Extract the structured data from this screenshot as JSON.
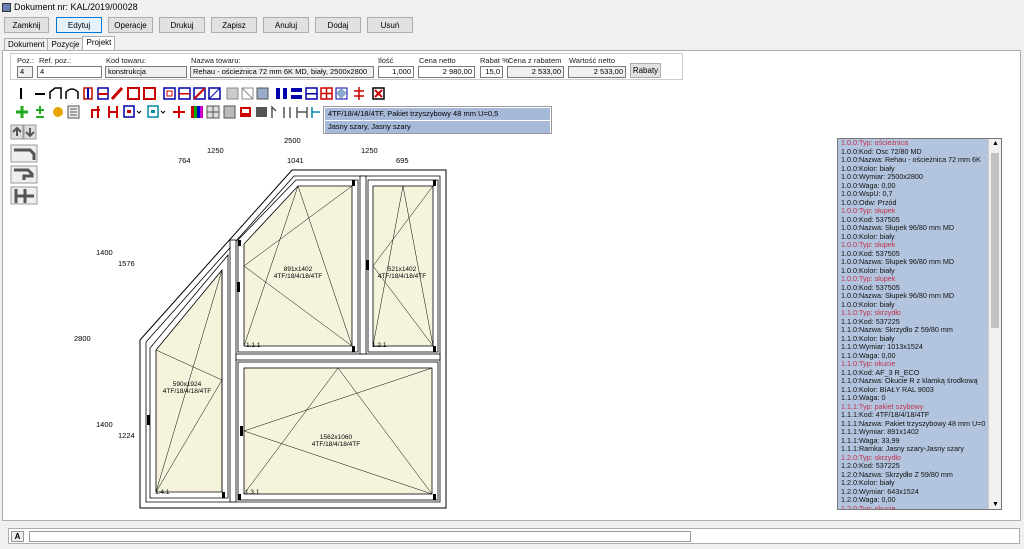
{
  "window": {
    "title": "Dokument nr: KAL/2019/00028"
  },
  "toolbar": {
    "buttons": [
      "Zamknij",
      "Edytuj",
      "Operacje",
      "Drukuj",
      "Zapisz",
      "Anuluj",
      "Dodaj",
      "Usuń"
    ]
  },
  "tabs": [
    "Dokument",
    "Pozycje",
    "Projekt"
  ],
  "form": {
    "poz_label": "Poz.:",
    "poz_value": "4",
    "refpoz_label": "Ref. poz.:",
    "refpoz_value": "4",
    "kod_label": "Kod towaru:",
    "kod_value": "konstrukcja",
    "nazwa_label": "Nazwa towaru:",
    "nazwa_value": "Rehau - ościeżnica 72 mm 6K MD, biały, 2500x2800",
    "ilosc_label": "Ilość",
    "ilosc_value": "1,000",
    "cena_label": "Cena netto",
    "cena_value": "2 980,00",
    "rabat_label": "Rabat %",
    "rabat_value": "15,0",
    "cenarabat_label": "Cena z rabatem",
    "cenarabat_value": "2 533,00",
    "wartosc_label": "Wartość netto",
    "wartosc_value": "2 533,00",
    "rabaty_button": "Rabaty"
  },
  "popup": {
    "line1": "4TF/18/4/18/4TF, Pakiet trzyszybowy 48 mm U=0,5",
    "line2": "Jasny szary, Jasny szary"
  },
  "drawing": {
    "dims": [
      "2500",
      "1250",
      "1250",
      "764",
      "1041",
      "695",
      "1400",
      "1576",
      "2800",
      "1400",
      "1224"
    ],
    "glass": [
      {
        "size": "891x1402",
        "spec": "4TF/18/4/18/4TF",
        "id": "1.1.1"
      },
      {
        "size": "521x1402",
        "spec": "4TF/18/4/18/4TF",
        "id": "1.2.1"
      },
      {
        "size": "590x1924",
        "spec": "4TF/18/4/18/4TF",
        "id": "1.4.1"
      },
      {
        "size": "1562x1060",
        "spec": "4TF/18/4/18/4TF",
        "id": "1.3.1"
      }
    ]
  },
  "properties": [
    {
      "t": "1.0.0:Typ: ościeżnica",
      "red": true
    },
    {
      "t": "1.0.0:Kod: Osc 72/80 MD"
    },
    {
      "t": "1.0.0:Nazwa: Rehau - ościeżnica 72 mm 6K"
    },
    {
      "t": "1.0.0:Kolor: biały"
    },
    {
      "t": "1.0.0:Wymiar: 2500x2800"
    },
    {
      "t": "1.0.0:Waga: 0,00"
    },
    {
      "t": "1.0.0:WspU: 0,7"
    },
    {
      "t": "1.0.0:Odw: Przód"
    },
    {
      "t": "1.0.0:Typ: słupek",
      "red": true
    },
    {
      "t": "1.0.0:Kod: 537505"
    },
    {
      "t": "1.0.0:Nazwa: Słupek 96/80 mm MD"
    },
    {
      "t": "1.0.0:Kolor: biały"
    },
    {
      "t": "1.0.0:Typ: słupek",
      "red": true
    },
    {
      "t": "1.0.0:Kod: 537505"
    },
    {
      "t": "1.0.0:Nazwa: Słupek 96/80 mm MD"
    },
    {
      "t": "1.0.0:Kolor: biały"
    },
    {
      "t": "1.0.0:Typ: słupek",
      "red": true
    },
    {
      "t": "1.0.0:Kod: 537505"
    },
    {
      "t": "1.0.0:Nazwa: Słupek 96/80 mm MD"
    },
    {
      "t": "1.0.0:Kolor: biały"
    },
    {
      "t": "1.1.0:Typ: skrzydło",
      "red": true
    },
    {
      "t": "1.1.0:Kod: 537225"
    },
    {
      "t": "1.1.0:Nazwa: Skrzydło Z 59/80 mm"
    },
    {
      "t": "1.1.0:Kolor: biały"
    },
    {
      "t": "1.1.0:Wymiar: 1013x1524"
    },
    {
      "t": "1.1.0:Waga: 0,00"
    },
    {
      "t": "1.1.0:Typ: okucie",
      "red": true
    },
    {
      "t": "1.1.0:Kod: AF_3 R_ECO"
    },
    {
      "t": "1.1.0:Nazwa: Okucie R z klamką środkową"
    },
    {
      "t": "1.1.0:Kolor: BIAŁY RAL 9003"
    },
    {
      "t": "1.1.0:Waga: 0"
    },
    {
      "t": "1.1.1:Typ: pakiet szybowy",
      "red": true
    },
    {
      "t": "1.1.1:Kod: 4TF/18/4/18/4TF"
    },
    {
      "t": "1.1.1:Nazwa: Pakiet trzyszybowy 48 mm U=0"
    },
    {
      "t": "1.1.1:Wymiar: 891x1402"
    },
    {
      "t": "1.1.1:Waga: 33,99"
    },
    {
      "t": "1.1.1:Ramka: Jasny szary-Jasny szary"
    },
    {
      "t": "1.2.0:Typ: skrzydło",
      "red": true
    },
    {
      "t": "1.2.0:Kod: 537225"
    },
    {
      "t": "1.2.0:Nazwa: Skrzydło Z 59/80 mm"
    },
    {
      "t": "1.2.0:Kolor: biały"
    },
    {
      "t": "1.2.0:Wymiar: 643x1524"
    },
    {
      "t": "1.2.0:Waga: 0,00"
    },
    {
      "t": "1.2.0:Typ: okucie",
      "red": true
    }
  ],
  "status": {
    "label": "A"
  }
}
